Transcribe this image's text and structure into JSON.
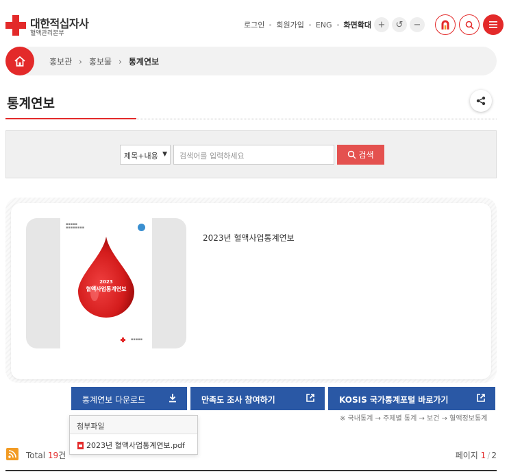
{
  "header": {
    "logo_name": "대한적십자사",
    "logo_sub": "혈액관리본부",
    "util_links": [
      "로그인",
      "회원가입",
      "ENG"
    ],
    "zoom_label": "화면확대",
    "zoom_in": "+",
    "zoom_reset": "↺",
    "zoom_out": "−"
  },
  "breadcrumb": {
    "items": [
      "홍보관",
      "홍보물"
    ],
    "current": "통계연보",
    "separator": "›"
  },
  "page": {
    "title": "통계연보"
  },
  "search": {
    "select_value": "제목+내용",
    "input_placeholder": "검색어를 입력하세요",
    "button_label": "검색"
  },
  "item": {
    "title": "2023년 혈액사업통계연보",
    "cover_year": "2023",
    "cover_title": "혈액사업통계연보"
  },
  "actions": {
    "download_label": "통계연보 다운로드",
    "survey_label": "만족도 조사 참여하기",
    "kosis_label": "KOSIS 국가통계포털 바로가기",
    "kosis_note": "※ 국내통계 → 주제별 통계 → 보건 → 혈액정보통계"
  },
  "attachment": {
    "header": "첨부파일",
    "file_name": "2023년 혈액사업통계연보.pdf"
  },
  "list_info": {
    "total_label": "Total",
    "total_count": "19",
    "total_unit": "건",
    "page_label": "페이지",
    "page_current": "1",
    "page_sep": "/",
    "page_total": "2"
  },
  "colors": {
    "brand_red": "#e32a2a",
    "button_blue": "#2a58a5",
    "search_red": "#e4514f",
    "rss_orange": "#f29b24"
  },
  "icons": [
    "home-icon",
    "share-icon",
    "search-icon",
    "download-icon",
    "external-link-icon",
    "pdf-icon",
    "rss-icon",
    "menu-icon",
    "blood-drop-icon"
  ]
}
